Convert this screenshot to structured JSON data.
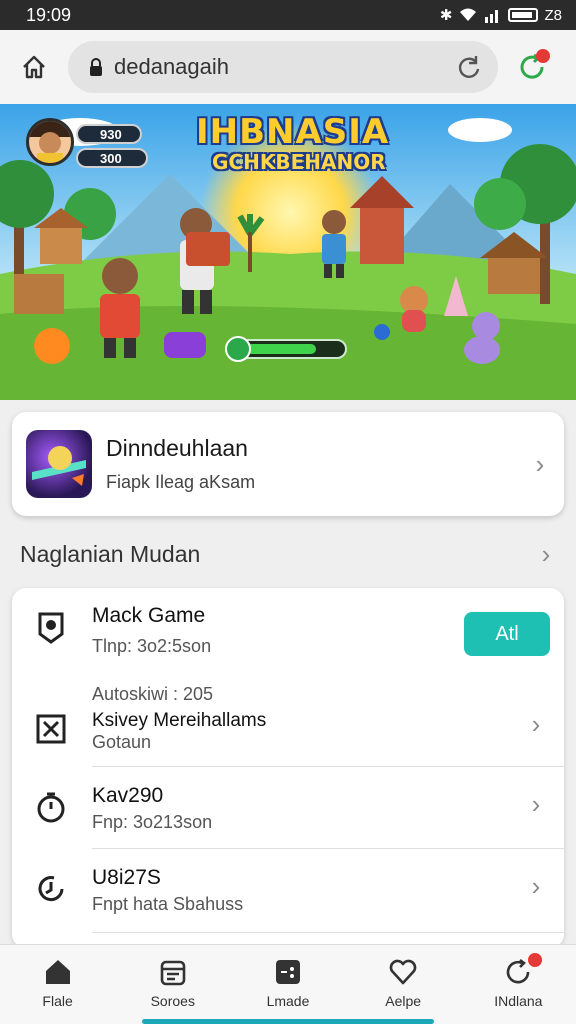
{
  "status_bar": {
    "time": "19:09",
    "battery": "Z8"
  },
  "browser": {
    "url": "dedanagaih"
  },
  "banner": {
    "title": "IHBNASIA",
    "subtitle": "GCHKBEHANOR",
    "pill_1": "930",
    "pill_2": "300"
  },
  "featured": {
    "title": "Dinndeuhlaan",
    "subtitle": "Fiapk Ileag aKsam"
  },
  "section": {
    "title": "Naglanian Mudan"
  },
  "list": {
    "items": [
      {
        "title": "Mack Game",
        "subtitle": "Tlnp: 3o2:5son",
        "action": "Atl",
        "meta": "Autoskiwi : 205"
      },
      {
        "title": "Ksivey Mereihallams",
        "subtitle": "Gotaun"
      },
      {
        "title": "Kav290",
        "subtitle": "Fnp: 3o213son"
      },
      {
        "title": "U8i27S",
        "subtitle": "Fnpt hata Sbahuss"
      }
    ]
  },
  "nav": {
    "items": [
      {
        "label": "Flale",
        "icon": "home-icon"
      },
      {
        "label": "Soroes",
        "icon": "calendar-icon"
      },
      {
        "label": "Lmade",
        "icon": "gamepad-icon"
      },
      {
        "label": "Aelpe",
        "icon": "heart-icon"
      },
      {
        "label": "INdlana",
        "icon": "refresh-icon"
      }
    ]
  },
  "colors": {
    "accent": "#1ec0b3",
    "badge": "#e53935",
    "indicator": "#1aa7b8"
  }
}
